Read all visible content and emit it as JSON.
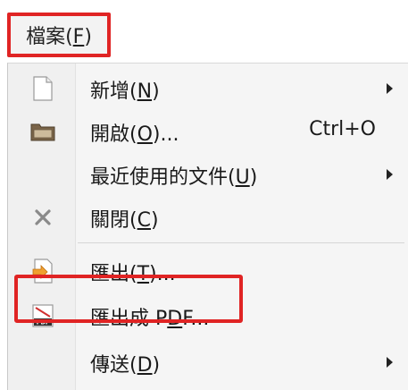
{
  "menubar": {
    "file_label": "檔案(",
    "file_mnemonic": "F",
    "file_close": ")"
  },
  "menu": {
    "items": [
      {
        "label_pre": "新增(",
        "mnemonic": "N",
        "label_post": ")",
        "shortcut": "",
        "icon": "blank-document-icon",
        "has_submenu": true
      },
      {
        "label_pre": "開啟(",
        "mnemonic": "O",
        "label_post": ")...",
        "shortcut": "Ctrl+O",
        "icon": "folder-icon",
        "has_submenu": false
      },
      {
        "label_pre": "最近使用的文件(",
        "mnemonic": "U",
        "label_post": ")",
        "shortcut": "",
        "icon": "",
        "has_submenu": true
      },
      {
        "label_pre": "關閉(",
        "mnemonic": "C",
        "label_post": ")",
        "shortcut": "",
        "icon": "close-x-icon",
        "has_submenu": false
      },
      {
        "label_pre": "匯出(",
        "mnemonic": "T",
        "label_post": ")...",
        "shortcut": "",
        "icon": "export-icon",
        "has_submenu": false
      },
      {
        "label_pre": "匯出成 P",
        "mnemonic": "D",
        "label_post": "F...",
        "shortcut": "",
        "icon": "pdf-icon",
        "has_submenu": false
      },
      {
        "label_pre": "傳送(",
        "mnemonic": "D",
        "label_post": ")",
        "shortcut": "",
        "icon": "",
        "has_submenu": true
      }
    ]
  },
  "colors": {
    "highlight": "#e02424",
    "menu_bg": "#f5f5f5"
  }
}
